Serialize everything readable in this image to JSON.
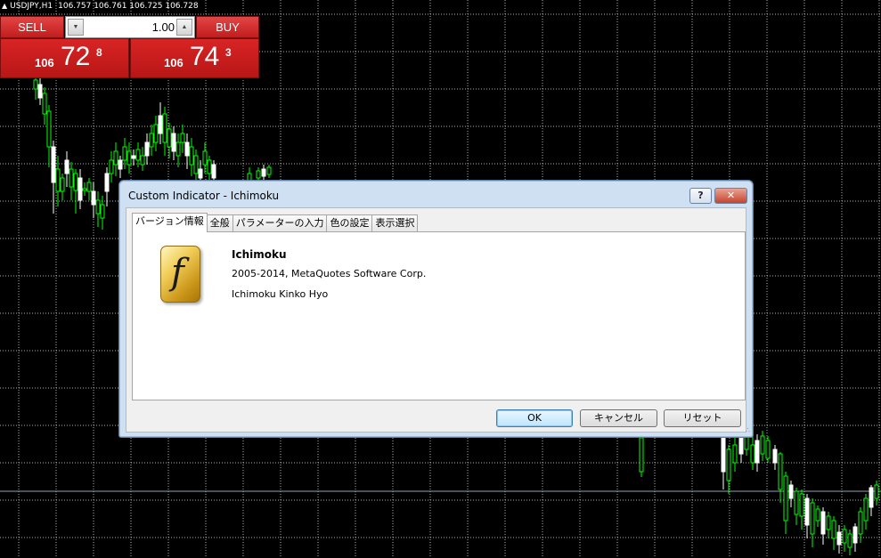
{
  "colors": {
    "background": "#000000",
    "grid": "#d0d0d0",
    "bull_candle": "#00ff00",
    "bear_candle": "#ffffff",
    "price_line": "#8fa0b8",
    "sell_buy": "#d42020"
  },
  "chart": {
    "symbol": "USDJPY,H1",
    "ohlc": "106.757 106.761 106.725 106.728"
  },
  "trade_panel": {
    "sell_label": "SELL",
    "buy_label": "BUY",
    "lot_value": "1.00",
    "sell_quote": {
      "prefix": "106",
      "big": "72",
      "sup": "8"
    },
    "buy_quote": {
      "prefix": "106",
      "big": "74",
      "sup": "3"
    }
  },
  "dialog": {
    "title": "Custom Indicator - Ichimoku",
    "help_label": "?",
    "tabs": [
      {
        "label": "バージョン情報",
        "active": true
      },
      {
        "label": "全般",
        "active": false
      },
      {
        "label": "パラメーターの入力",
        "active": false
      },
      {
        "label": "色の設定",
        "active": false
      },
      {
        "label": "表示選択",
        "active": false
      }
    ],
    "about": {
      "logo_glyph": "f",
      "name": "Ichimoku",
      "copyright": "2005-2014, MetaQuotes Software Corp.",
      "description": "Ichimoku Kinko Hyo"
    },
    "buttons": {
      "ok": "OK",
      "cancel": "キャンセル",
      "reset": "リセット"
    }
  },
  "icons": {
    "close": "close-icon",
    "help": "help-icon",
    "spin_down": "spin-down-icon",
    "spin_up": "spin-up-icon",
    "indicator_logo": "indicator-logo-icon"
  }
}
